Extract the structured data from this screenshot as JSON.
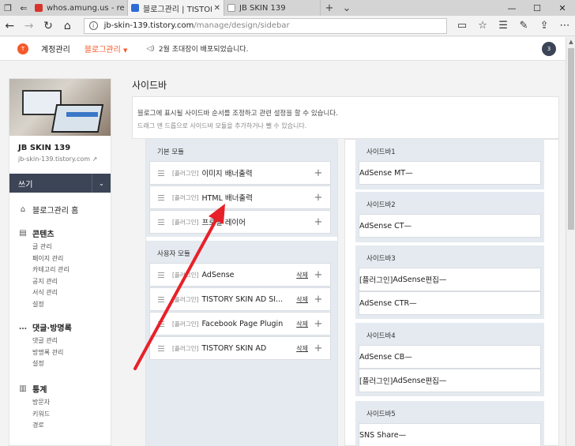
{
  "browser": {
    "tabs": [
      {
        "label": "whos.amung.us - real-time :",
        "color": "#d9342b"
      },
      {
        "label": "블로그관리 | TISTORY",
        "color": "#2d6bd6"
      },
      {
        "label": "JB SKIN 139",
        "color": "#888888"
      }
    ],
    "url_host": "jb-skin-139.tistory.com",
    "url_path": "/manage/design/sidebar"
  },
  "header": {
    "account": "계정관리",
    "blog_manage": "블로그관리",
    "notice": "2월 초대장이 배포되었습니다.",
    "avatar_text": "3"
  },
  "leftnav": {
    "blog_title": "JB SKIN 139",
    "blog_url": "jb-skin-139.tistory.com",
    "write_label": "쓰기",
    "home_label": "블로그관리 홈",
    "sections": [
      {
        "title": "콘텐츠",
        "icon": "document-icon",
        "items": [
          "글 관리",
          "페이지 관리",
          "카테고리 관리",
          "공지 관리",
          "서식 관리",
          "설정"
        ]
      },
      {
        "title": "댓글·방명록",
        "icon": "speech-icon",
        "items": [
          "댓글 관리",
          "방명록 관리",
          "설정"
        ]
      },
      {
        "title": "통계",
        "icon": "chart-icon",
        "items": [
          "방문자",
          "키워드",
          "경로"
        ]
      }
    ]
  },
  "main": {
    "title": "사이드바",
    "desc1": "블로그에 표시될 사이드바 순서를 조정하고 관련 설정을 할 수 있습니다.",
    "desc2": "드래그 앤 드롭으로 사이드바 모듈을 추가하거나 뺄 수 있습니다.",
    "basic_group": {
      "title": "기본 모듈",
      "items": [
        {
          "plugin": "[플러그인]",
          "name": "이미지 배너출력"
        },
        {
          "plugin": "[플러그인]",
          "name": "HTML 배너출력"
        },
        {
          "plugin": "[플러그인]",
          "name": "프로필 레이어"
        }
      ]
    },
    "user_group": {
      "title": "사용자 모듈",
      "items": [
        {
          "plugin": "[플러그인]",
          "name": "AdSense",
          "del": "삭제"
        },
        {
          "plugin": "[플러그인]",
          "name": "TISTORY SKIN AD SI...",
          "del": "삭제"
        },
        {
          "plugin": "[플러그인]",
          "name": "Facebook Page Plugin",
          "del": "삭제"
        },
        {
          "plugin": "[플러그인]",
          "name": "TISTORY SKIN AD",
          "del": "삭제"
        }
      ]
    },
    "sidebars": [
      {
        "title": "사이드바1",
        "items": [
          {
            "plugin": "",
            "name": "AdSense MT",
            "edit": ""
          }
        ]
      },
      {
        "title": "사이드바2",
        "items": [
          {
            "plugin": "",
            "name": "AdSense CT",
            "edit": ""
          }
        ]
      },
      {
        "title": "사이드바3",
        "items": [
          {
            "plugin": "[플러그인]",
            "name": "AdSense",
            "edit": "편집"
          },
          {
            "plugin": "",
            "name": "AdSense CTR",
            "edit": ""
          }
        ]
      },
      {
        "title": "사이드바4",
        "items": [
          {
            "plugin": "",
            "name": "AdSense CB",
            "edit": ""
          },
          {
            "plugin": "[플러그인]",
            "name": "AdSense",
            "edit": "편집"
          }
        ]
      },
      {
        "title": "사이드바5",
        "items": [
          {
            "plugin": "",
            "name": "SNS Share",
            "edit": ""
          }
        ]
      }
    ]
  },
  "annotation_color": "#e8202a"
}
